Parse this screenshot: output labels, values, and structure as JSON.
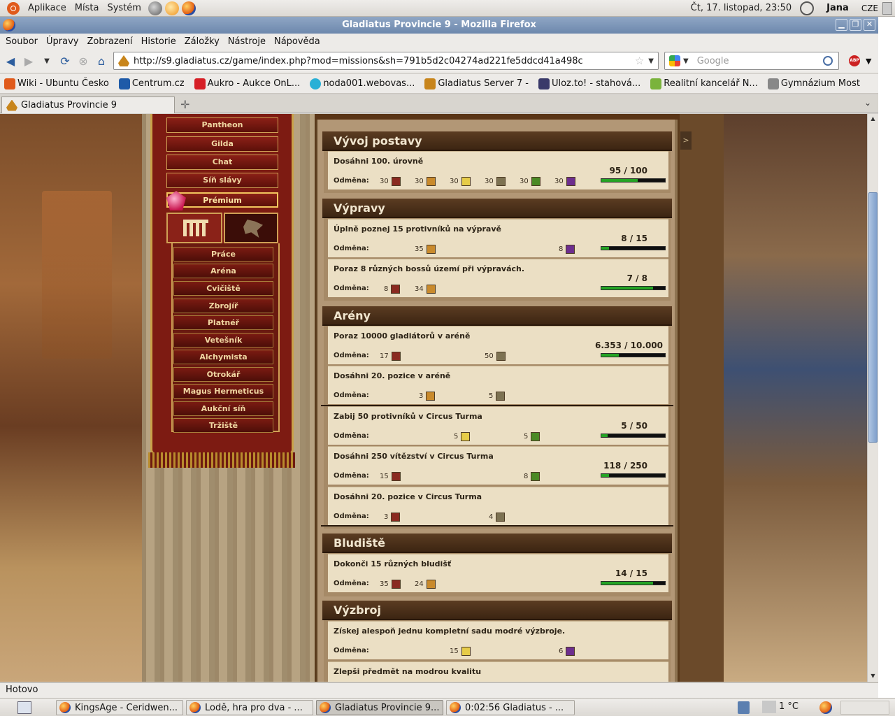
{
  "top_panel": {
    "menus": [
      "Aplikace",
      "Místa",
      "Systém"
    ],
    "clock": "Čt, 17. listopad, 23:50",
    "user": "Jana",
    "lang": "CZE"
  },
  "window": {
    "title": "Gladiatus Provincie 9 - Mozilla Firefox",
    "buttons": [
      "▁",
      "❐",
      "✕"
    ]
  },
  "menubar": [
    "Soubor",
    "Úpravy",
    "Zobrazení",
    "Historie",
    "Záložky",
    "Nástroje",
    "Nápověda"
  ],
  "navbar": {
    "url": "http://s9.gladiatus.cz/game/index.php?mod=missions&sh=791b5d2c04274ad221fe5ddcd41a498c",
    "search_placeholder": "Google",
    "abp_label": "ABP"
  },
  "bookmarks": [
    {
      "label": "Wiki - Ubuntu Česko",
      "color": "#e05a1b"
    },
    {
      "label": "Centrum.cz",
      "color": "#1e5aa8"
    },
    {
      "label": "Aukro - Aukce OnL...",
      "color": "#d61f26"
    },
    {
      "label": "noda001.webovas...",
      "color": "#2ab0d6"
    },
    {
      "label": "Gladiatus Server 7 -",
      "color": "#c8851b"
    },
    {
      "label": "Uloz.to! - stahová...",
      "color": "#3a3a6a"
    },
    {
      "label": "Realitní kancelář N...",
      "color": "#7ab33c"
    },
    {
      "label": "Gymnázium Most",
      "color": "#888888"
    }
  ],
  "tab": {
    "label": "Gladiatus Provincie 9",
    "newtab": "✛",
    "list": "⌄"
  },
  "game_nav": {
    "main": [
      "Pantheon",
      "Gilda",
      "Chat",
      "Síň slávy",
      "Prémium"
    ],
    "sub": [
      "Práce",
      "Aréna",
      "Cvičiště",
      "Zbrojíř",
      "Platnéř",
      "Vetešník",
      "Alchymista",
      "Otrokář",
      "Magus Hermeticus",
      "Aukční síň",
      "Tržiště"
    ]
  },
  "missions": {
    "reward_label": "Odměna:",
    "sections": [
      {
        "title": "Vývoj postavy"
      },
      {
        "title": "Výpravy"
      },
      {
        "title": "Arény"
      },
      {
        "title": "Bludiště"
      },
      {
        "title": "Výzbroj"
      }
    ],
    "items": [
      {
        "title": "Dosáhni 100. úrovně",
        "progress": "95 / 100",
        "fill": 0.57,
        "rewards": [
          "30",
          "30",
          "30",
          "30",
          "30",
          "30"
        ]
      },
      {
        "title": "Úplně poznej 15 protivníků na výpravě",
        "progress": "8 / 15",
        "fill": 0.12,
        "rewards": [
          "35",
          "8"
        ]
      },
      {
        "title": "Poraz 8 různých bossů území při výpravách.",
        "progress": "7 / 8",
        "fill": 0.81,
        "rewards": [
          "8",
          "34"
        ]
      },
      {
        "title": "Poraz 10000 gladiátorů v aréně",
        "progress": "6.353 / 10.000",
        "fill": 0.27,
        "rewards": [
          "17",
          "50"
        ]
      },
      {
        "title": "Dosáhni 20. pozice v aréně",
        "progress": "",
        "fill": 0,
        "rewards": [
          "3",
          "5"
        ]
      },
      {
        "title": "Zabij 50 protivníků v Circus Turma",
        "progress": "5 / 50",
        "fill": 0.1,
        "rewards": [
          "5",
          "5"
        ]
      },
      {
        "title": "Dosáhni 250 vítězství v Circus Turma",
        "progress": "118 / 250",
        "fill": 0.12,
        "rewards": [
          "15",
          "8"
        ]
      },
      {
        "title": "Dosáhni 20. pozice v Circus Turma",
        "progress": "",
        "fill": 0,
        "rewards": [
          "3",
          "4"
        ]
      },
      {
        "title": "Dokonči 15 různých bludišť",
        "progress": "14 / 15",
        "fill": 0.81,
        "rewards": [
          "35",
          "24"
        ]
      },
      {
        "title": "Získej alespoň jednu kompletní sadu modré výzbroje.",
        "progress": "",
        "fill": 0,
        "rewards": [
          "15",
          "6"
        ]
      },
      {
        "title": "Zlepši předmět na modrou kvalitu",
        "progress": "",
        "fill": 0,
        "rewards": []
      }
    ]
  },
  "statusbar": "Hotovo",
  "taskbar": {
    "items": [
      "KingsAge - Ceridwen...",
      "Lodě, hra pro dva - ...",
      "Gladiatus Provincie 9...",
      "0:02:56 Gladiatus - ..."
    ],
    "temperature": "1 °C"
  }
}
